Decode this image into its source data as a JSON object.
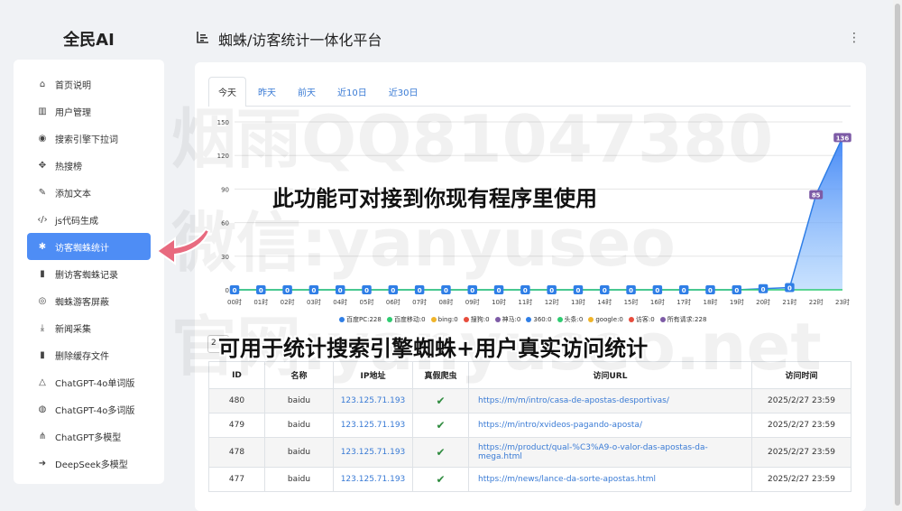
{
  "brand": "全民AI",
  "page_title": "蜘蛛/访客统计一体化平台",
  "sidebar": {
    "items": [
      {
        "label": "首页说明",
        "icon": "home-icon",
        "glyph": "⌂"
      },
      {
        "label": "用户管理",
        "icon": "bank-icon",
        "glyph": "▥"
      },
      {
        "label": "搜索引擎下拉词",
        "icon": "mouse-icon",
        "glyph": "◉"
      },
      {
        "label": "热搜榜",
        "icon": "paw-icon",
        "glyph": "✥"
      },
      {
        "label": "添加文本",
        "icon": "edit-icon",
        "glyph": "✎"
      },
      {
        "label": "js代码生成",
        "icon": "code-icon",
        "glyph": "‹/›"
      },
      {
        "label": "访客蜘蛛统计",
        "icon": "spider-icon",
        "glyph": "✱"
      },
      {
        "label": "删访客蜘蛛记录",
        "icon": "trash-icon",
        "glyph": "▮"
      },
      {
        "label": "蜘蛛游客屏蔽",
        "icon": "eye-slash-icon",
        "glyph": "◎"
      },
      {
        "label": "新闻采集",
        "icon": "download-icon",
        "glyph": "⤓"
      },
      {
        "label": "删除缓存文件",
        "icon": "trash-icon",
        "glyph": "▮"
      },
      {
        "label": "ChatGPT-4o单词版",
        "icon": "google-drive-icon",
        "glyph": "△"
      },
      {
        "label": "ChatGPT-4o多词版",
        "icon": "basketball-icon",
        "glyph": "◍"
      },
      {
        "label": "ChatGPT多模型",
        "icon": "sitemap-icon",
        "glyph": "⋔"
      },
      {
        "label": "DeepSeek多模型",
        "icon": "deepseek-icon",
        "glyph": "➜"
      }
    ]
  },
  "tabs": [
    "今天",
    "昨天",
    "前天",
    "近10日",
    "近30日"
  ],
  "chart_data": {
    "type": "area",
    "categories": [
      "00时",
      "01时",
      "02时",
      "03时",
      "04时",
      "05时",
      "06时",
      "07时",
      "08时",
      "09时",
      "10时",
      "11时",
      "12时",
      "13时",
      "14时",
      "15时",
      "16时",
      "17时",
      "18时",
      "19时",
      "20时",
      "21时",
      "22时",
      "23时"
    ],
    "ylim": [
      0,
      150
    ],
    "yticks": [
      "0",
      "30",
      "60",
      "90",
      "120",
      "150"
    ],
    "grid": true,
    "legend_position": "bottom",
    "series": [
      {
        "name": "百度PC:228",
        "color": "#2f7ee6",
        "values": [
          0,
          0,
          0,
          0,
          0,
          0,
          0,
          0,
          0,
          0,
          0,
          0,
          0,
          0,
          0,
          0,
          0,
          0,
          0,
          0,
          1,
          2,
          85,
          136
        ],
        "labels": [
          "0",
          "0",
          "0",
          "0",
          "0",
          "0",
          "0",
          "0",
          "0",
          "0",
          "0",
          "0",
          "0",
          "0",
          "0",
          "0",
          "0",
          "0",
          "0",
          "0",
          "0",
          "0",
          "85",
          "136"
        ]
      },
      {
        "name": "百度移动:0",
        "color": "#2ecc71",
        "values": [
          0,
          0,
          0,
          0,
          0,
          0,
          0,
          0,
          0,
          0,
          0,
          0,
          0,
          0,
          0,
          0,
          0,
          0,
          0,
          0,
          0,
          0,
          0,
          0
        ]
      },
      {
        "name": "bing:0",
        "color": "#f0b429",
        "values": []
      },
      {
        "name": "搜狗:0",
        "color": "#e74c3c",
        "values": []
      },
      {
        "name": "神马:0",
        "color": "#7d5ba6",
        "values": []
      },
      {
        "name": "360:0",
        "color": "#2f7ee6",
        "values": []
      },
      {
        "name": "头条:0",
        "color": "#2ecc71",
        "values": []
      },
      {
        "name": "google:0",
        "color": "#f0b429",
        "values": []
      },
      {
        "name": "访客:0",
        "color": "#e74c3c",
        "values": []
      },
      {
        "name": "所有请求:228",
        "color": "#7d5ba6",
        "values": []
      }
    ]
  },
  "toolbar_value": "2",
  "table": {
    "headers": [
      "ID",
      "名称",
      "IP地址",
      "真假爬虫",
      "访问URL",
      "访问时间"
    ],
    "rows": [
      {
        "id": "480",
        "name": "baidu",
        "ip": "123.125.71.193",
        "url": "https://m/m/intro/casa-de-apostas-desportivas/",
        "time": "2025/2/27 23:59"
      },
      {
        "id": "479",
        "name": "baidu",
        "ip": "123.125.71.193",
        "url": "https://m/intro/xvideos-pagando-aposta/",
        "time": "2025/2/27 23:59"
      },
      {
        "id": "478",
        "name": "baidu",
        "ip": "123.125.71.193",
        "url": "https://m/product/qual-%C3%A9-o-valor-das-apostas-da-mega.html",
        "time": "2025/2/27 23:59"
      },
      {
        "id": "477",
        "name": "baidu",
        "ip": "123.125.71.193",
        "url": "https://m/news/lance-da-sorte-apostas.html",
        "time": "2025/2/27 23:59"
      }
    ]
  },
  "watermarks": [
    "烟雨QQ81047380",
    "微信:yanyuseo",
    "官网:yanyuseo.net"
  ],
  "captions": [
    "此功能可对接到你现有程序里使用",
    "可用于统计搜索引擎蜘蛛+用户真实访问统计"
  ]
}
